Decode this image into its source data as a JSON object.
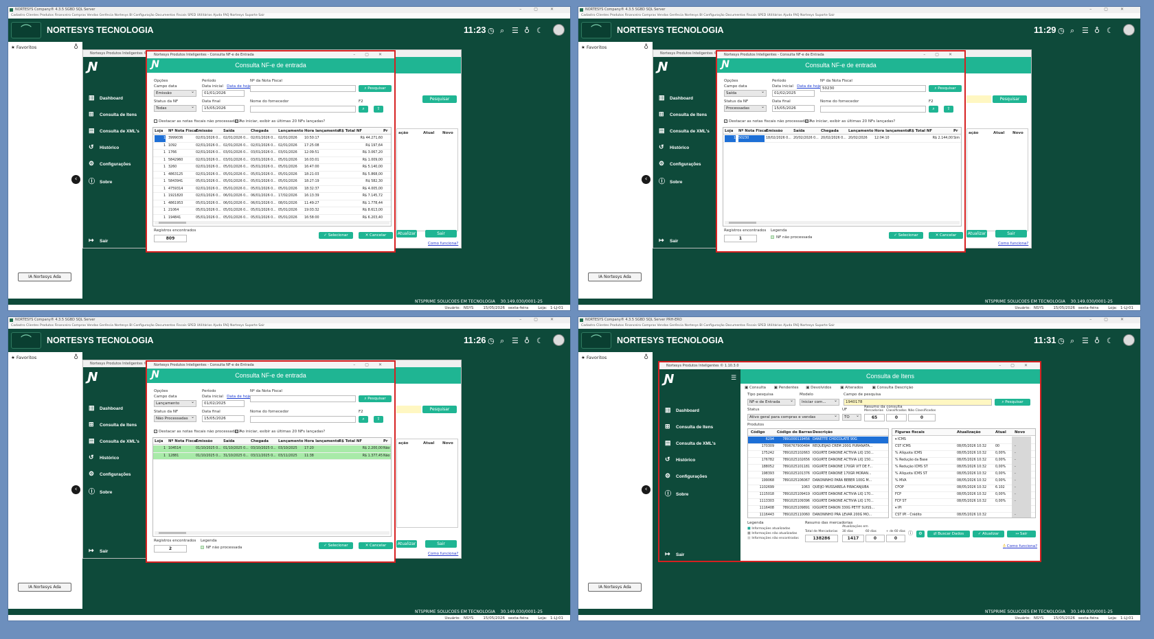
{
  "app_title": "NORTESYS Company® 4.3.5 SGBD SQL Server",
  "app_title_q4": "NORTESYS Company® 4.3.5 SGBD SQL Server PRH-ERO",
  "menu": [
    "Cadastro",
    "Clientes",
    "Produtos",
    "Financeiro",
    "Compras",
    "Vendas",
    "Gerência",
    "Nortesys BI",
    "Configuração",
    "Documentos Fiscais",
    "SPED",
    "Utilitários",
    "Ajuda",
    "FAQ Nortesys",
    "Suporte",
    "Sair"
  ],
  "brand": "NORTESYS TECNOLOGIA",
  "clocks": [
    "11:23",
    "11:29",
    "11:26",
    "11:31"
  ],
  "favorites": "Favoritos",
  "ia_button": "IA Nortesys Ada",
  "company_footer": "NTSPRIME SOLUCOES EM TECNOLOGIA",
  "cnpj": "30.149.030/0001-25",
  "user": "Usuário: NSYS",
  "date": "15/05/2026 sexta-feira",
  "store": "Loja: 1-LJ-01",
  "inner_title": "Nortesys Produtos Inteligentes © 1.10.3.0",
  "inner_title_short": "Nortesys Produtos Inteligentes © 1.10.",
  "nav": [
    "Dashboard",
    "Consulta de Itens",
    "Consulta de XML's",
    "Histórico",
    "Configurações",
    "Sobre"
  ],
  "nav_exit": "Sair",
  "bg": {
    "pesquisar": "Pesquisar",
    "col_acao": "ação",
    "col_atual": "Atual",
    "col_novo": "Novo",
    "atualizar": "Atualizar",
    "sair": "Sair",
    "como": "Como funciona?"
  },
  "nf": {
    "title_bar": "Nortesys Produtos Inteligentes - Consulta NF-e de Entrada",
    "heading": "Consulta NF-e de entrada",
    "opcoes": "Opções",
    "campo_data": "Campo data",
    "status_nf": "Status da NF",
    "periodo": "Período",
    "data_inicial": "Data inicial",
    "data_hoje": "Data de hoje",
    "data_final": "Data final",
    "nota_label": "Nº da Nota Fiscal",
    "fornecedor_label": "Nome do fornecedor",
    "f2": "F2",
    "pesquisar": "Pesquisar",
    "chk1": "Destacar as notas fiscais não processadas?",
    "chk2": "Ao iniciar, exibir as últimas 20 NFs lançadas?",
    "cols": [
      "Loja",
      "Nº Nota Fiscal",
      "Emissão",
      "Saída",
      "Chegada",
      "Lançamento",
      "Hora lançamento",
      "R$ Total NF",
      "Pr"
    ],
    "registros": "Registros encontrados",
    "legenda": "Legenda",
    "legenda_item": "NF não processada",
    "selecionar": "Selecionar",
    "cancelar": "Cancelar"
  },
  "q1": {
    "campo": "Emissão",
    "status": "Todas",
    "di": "01/01/2026",
    "df": "15/05/2026",
    "nota": "",
    "count": "809",
    "rows": [
      [
        "1",
        "3999036",
        "02/01/2026 0...",
        "02/01/2026 0...",
        "02/01/2026 0...",
        "02/01/2026",
        "10:50:17",
        "R$ 44.271,60"
      ],
      [
        "1",
        "1092",
        "02/01/2026 0...",
        "02/01/2026 0...",
        "02/01/2026 0...",
        "02/01/2026",
        "17:25:08",
        "R$ 197,64"
      ],
      [
        "1",
        "1766",
        "02/01/2026 0...",
        "03/01/2026 0...",
        "03/01/2026 0...",
        "03/01/2026",
        "12:09:51",
        "R$ 3.067,20"
      ],
      [
        "1",
        "5842960",
        "02/01/2026 0...",
        "03/01/2026 0...",
        "03/01/2026 0...",
        "05/01/2026",
        "16:03:01",
        "R$ 1.009,00"
      ],
      [
        "1",
        "3260",
        "02/01/2026 0...",
        "05/01/2026 0...",
        "05/01/2026 0...",
        "05/01/2026",
        "16:47:00",
        "R$ 5.140,00"
      ],
      [
        "1",
        "4863125",
        "02/01/2026 0...",
        "05/01/2026 0...",
        "05/01/2026 0...",
        "05/01/2026",
        "18:21:03",
        "R$ 5.868,00"
      ],
      [
        "1",
        "5843941",
        "05/01/2026 0...",
        "05/01/2026 0...",
        "05/01/2026 0...",
        "05/01/2026",
        "18:27:19",
        "R$ 582,30"
      ],
      [
        "1",
        "4759314",
        "02/01/2026 0...",
        "05/01/2026 0...",
        "05/01/2026 0...",
        "05/01/2026",
        "18:32:37",
        "R$ 4.005,00"
      ],
      [
        "1",
        "1921820",
        "02/01/2026 0...",
        "06/01/2026 0...",
        "06/01/2026 0...",
        "17/02/2026",
        "16:13:39",
        "R$ 7.145,72"
      ],
      [
        "1",
        "4861953",
        "05/01/2026 0...",
        "06/01/2026 0...",
        "06/01/2026 0...",
        "08/01/2026",
        "11:49:27",
        "R$ 1.778,44"
      ],
      [
        "1",
        "21064",
        "05/01/2026 0...",
        "05/01/2026 0...",
        "05/01/2026 0...",
        "05/01/2026",
        "19:03:32",
        "R$ 8.613,00"
      ],
      [
        "1",
        "194841",
        "05/01/2026 0...",
        "05/01/2026 0...",
        "05/01/2026 0...",
        "05/01/2026",
        "16:58:00",
        "R$ 6.203,40"
      ]
    ]
  },
  "q2": {
    "campo": "Saída",
    "status": "Processadas",
    "di": "01/02/2025",
    "df": "15/05/2026",
    "nota": "50230",
    "count": "1",
    "rows": [
      [
        "1",
        "50230",
        "18/02/2026 0...",
        "20/02/2026 0...",
        "20/02/2026 0...",
        "20/02/2026",
        "12:04:10",
        "R$ 2.144,00",
        "Sim"
      ]
    ]
  },
  "q3": {
    "campo": "Lançamento",
    "status": "Não Processadas",
    "di": "01/02/2025",
    "df": "15/05/2026",
    "nota": "",
    "count": "2",
    "rows": [
      [
        "1",
        "104514",
        "01/10/2025 0...",
        "01/10/2025 0...",
        "03/10/2025 0...",
        "03/10/2025",
        "17:20",
        "R$ 2.200,00",
        "Não"
      ],
      [
        "1",
        "12881",
        "01/10/2025 0...",
        "31/10/2025 0...",
        "03/11/2025 0...",
        "03/11/2025",
        "11:38",
        "R$ 1.377,45",
        "Não"
      ]
    ]
  },
  "ci": {
    "title_bar": "Nortesys Produtos Inteligentes © 1.10.3.0",
    "heading": "Consulta de Itens",
    "tabs": [
      "Consulta",
      "Pendentes",
      "Devolvidos",
      "Alterados",
      "Consulta Descrição"
    ],
    "tipo_label": "Tipo pesquisa",
    "tipo": "NF-e de Entrada",
    "modelo_label": "Modelo",
    "modelo": "Iniciar com...",
    "campo_label": "Campo de pesquisa",
    "campo": "1940178",
    "status_label": "Status",
    "status": "Ativo geral para compras e vendas",
    "uf_label": "UF",
    "uf": "TO",
    "resumo_label": "Resumo da consulta",
    "res_cols": [
      "Mercadorias",
      "Classificados",
      "Não Classificados"
    ],
    "res_vals": [
      "65",
      "0",
      "0"
    ],
    "produtos": "Produtos",
    "pcols": [
      "Código",
      "Código de Barras",
      "Descrição"
    ],
    "prows": [
      [
        "6294",
        "7891000119456",
        "DANETTE CHOCOLATE 90G"
      ],
      [
        "170309",
        "7896767900484",
        "REQUEIJAO CREM 200G PURANATA..."
      ],
      [
        "175242",
        "7891025102663",
        "IOGURTE DANONE ACTIVIA LIQ 150..."
      ],
      [
        "176782",
        "7891025102656",
        "IOGURTE DANONE ACTIVIA LIQ 150..."
      ],
      [
        "188052",
        "7891025101181",
        "IOGURTE DANONE 170GR VIT DE F..."
      ],
      [
        "198393",
        "7891025101376",
        "IOGURTE DANONE 170GR MORAN..."
      ],
      [
        "199068",
        "7891025106067",
        "DANONINHO PARA BEBER 100G M..."
      ],
      [
        "1102699",
        "1063",
        "QUEIJO MUSSARELA PIRACANJUBA"
      ],
      [
        "1115018",
        "7891025109419",
        "IOGURTE DANONE ACTIVIA LIQ 170..."
      ],
      [
        "1113303",
        "7891025109396",
        "IOGURTE DANONE ACTIVIA LIQ 170..."
      ],
      [
        "1116408",
        "7891025109891",
        "IOGURTE DANON 330G PETIT SUISS..."
      ],
      [
        "1116443",
        "7891025110060",
        "DANONINHO PRA LEVAR 200G MO..."
      ]
    ],
    "fcols": [
      "Figuras fiscais",
      "Atualização",
      "Atual",
      "Novo"
    ],
    "frows": [
      [
        "ICMS",
        "",
        "",
        ""
      ],
      [
        "CST ICMS",
        "08/05/2026 10:32",
        "00",
        "-"
      ],
      [
        "% Alíquota ICMS",
        "08/05/2026 10:32",
        "0,00%",
        "-"
      ],
      [
        "% Redução da Base",
        "08/05/2026 10:32",
        "0,00%",
        "-"
      ],
      [
        "% Redução ICMS ST",
        "08/05/2026 10:32",
        "0,00%",
        "-"
      ],
      [
        "% Alíquota ICMS ST",
        "08/05/2026 10:32",
        "0,00%",
        "-"
      ],
      [
        "% MVA",
        "08/05/2026 10:32",
        "0,00%",
        "-"
      ],
      [
        "CFOP",
        "08/05/2026 10:32",
        "6.102",
        "-"
      ],
      [
        "FCP",
        "08/05/2026 10:32",
        "0,00%",
        "-"
      ],
      [
        "FCP ST",
        "08/05/2026 10:32",
        "0,00%",
        "-"
      ],
      [
        "IPI",
        "",
        "",
        ""
      ],
      [
        "CST IPI - Crédito",
        "08/05/2026 10:32",
        "",
        "-"
      ]
    ],
    "legenda": "Legenda",
    "leg_items": [
      "Informações atualizadas",
      "Informações não atualizadas",
      "Informações não encontradas"
    ],
    "resumo_merc": "Resumo das mercadorias",
    "total_label": "Total de Mercadorias",
    "total": "138286",
    "atual_label": "Atualizações em",
    "at_cols": [
      "30 dias",
      "60 dias",
      "+ de 60 dias"
    ],
    "at_vals": [
      "1417",
      "0",
      "0"
    ],
    "buscar": "Buscar Dados",
    "atualizar": "Atualizar",
    "sair": "Sair",
    "como": "Como funciona?"
  }
}
